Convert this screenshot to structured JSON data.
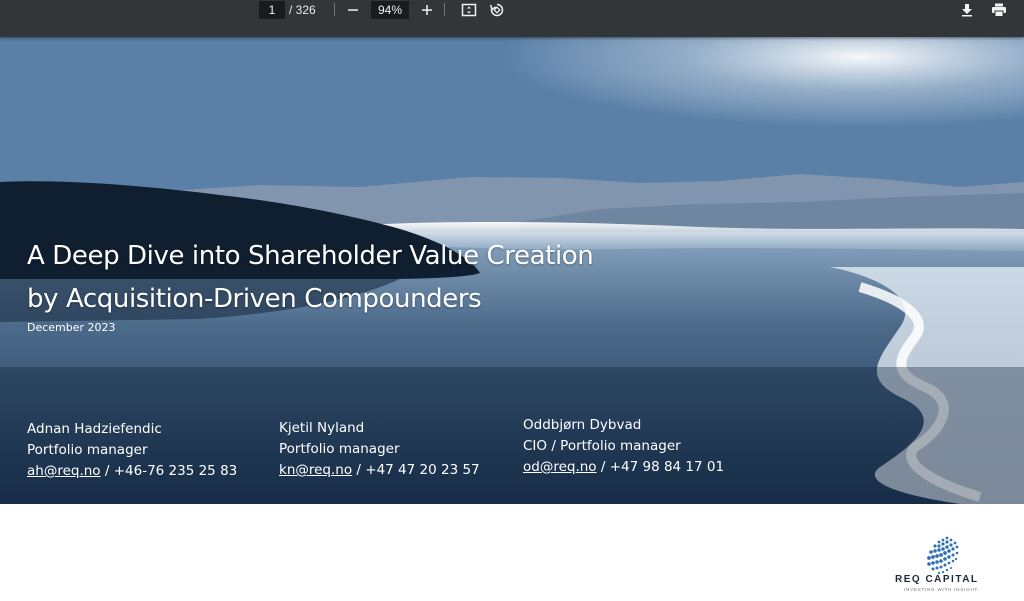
{
  "toolbar": {
    "page_current": "1",
    "page_total": "/ 326",
    "zoom": "94%",
    "icons": [
      "minus-icon",
      "plus-icon",
      "fit-page-icon",
      "rotate-icon",
      "download-icon",
      "print-icon"
    ]
  },
  "slide": {
    "title_line1": "A Deep Dive into Shareholder Value Creation",
    "title_line2": "by Acquisition-Driven Compounders",
    "date": "December 2023",
    "contacts": [
      {
        "name": "Adnan Hadziefendic",
        "role": "Portfolio manager",
        "email": "ah@req.no",
        "phone": " / +46-76 235 25 83"
      },
      {
        "name": "Kjetil Nyland",
        "role": "Portfolio manager",
        "email": "kn@req.no",
        "phone": " / +47 47 20 23 57"
      },
      {
        "name": "Oddbjørn Dybvad",
        "role": "CIO / Portfolio manager",
        "email": "od@req.no",
        "phone": " / +47 98 84 17 01"
      }
    ]
  },
  "logo": {
    "name": "REQ CAPITAL",
    "tagline": "INVESTING WITH INSIGHT"
  },
  "colors": {
    "toolbar_bg": "#323639",
    "text_white": "#ffffff",
    "logo_navy": "#1e2a3c"
  }
}
